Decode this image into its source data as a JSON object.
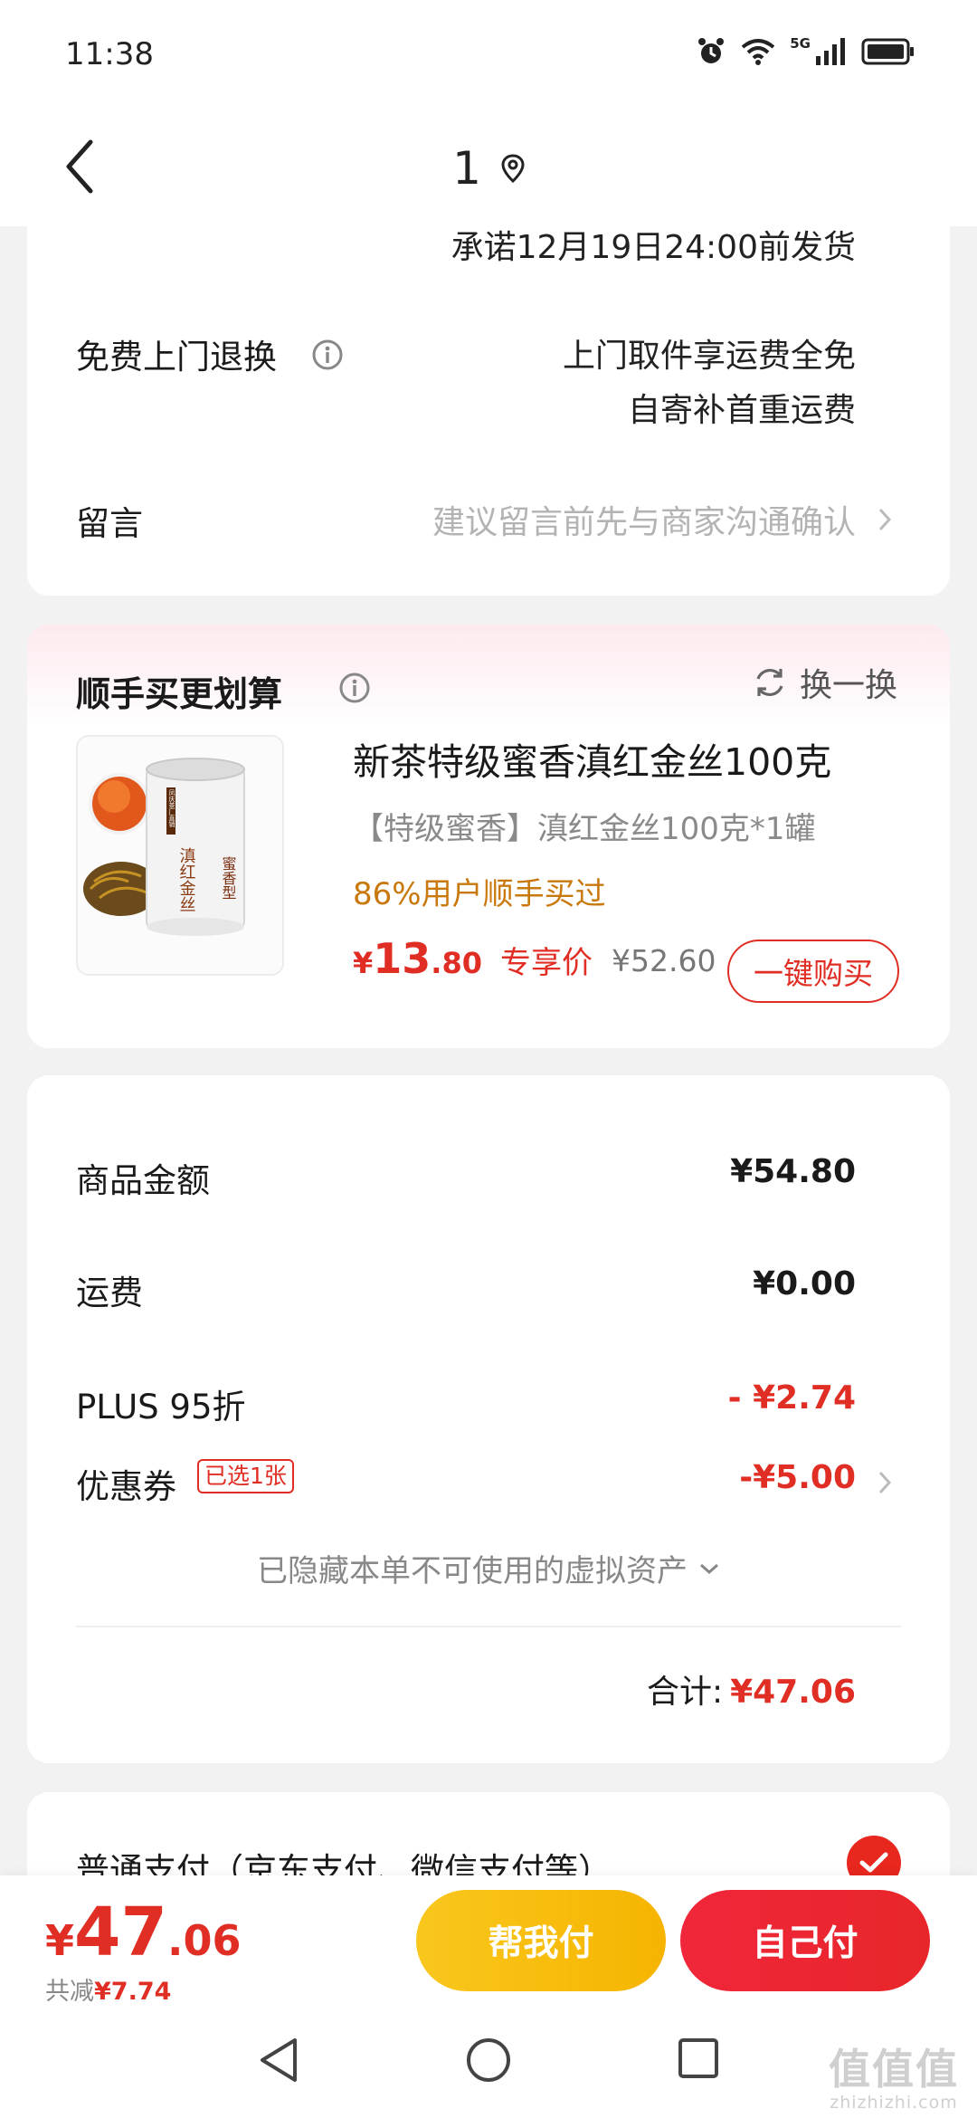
{
  "status_bar": {
    "time": "11:38",
    "network": "5G"
  },
  "nav": {
    "title": "1"
  },
  "delivery": {
    "promise": "承诺12月19日24:00前发货",
    "return_label": "免费上门退换",
    "return_line1": "上门取件享运费全免",
    "return_line2": "自寄补首重运费",
    "message_label": "留言",
    "message_placeholder": "建议留言前先与商家沟通确认"
  },
  "upsell": {
    "title": "顺手买更划算",
    "refresh_label": "换一换",
    "product_name": "新茶特级蜜香滇红金丝100克",
    "product_spec": "【特级蜜香】滇红金丝100克*1罐",
    "social_proof": "86%用户顺手买过",
    "price_symbol": "¥",
    "price_int": "13",
    "price_dec": ".80",
    "price_tag": "专享价",
    "original_price": "¥52.60",
    "buy_label": "一键购买",
    "image_text": {
      "side": "滇红金丝",
      "label": "蜜香型",
      "top": "凤庆茶厂直销"
    }
  },
  "summary": {
    "goods_label": "商品金额",
    "goods_value": "¥54.80",
    "shipping_label": "运费",
    "shipping_value": "¥0.00",
    "plus_label": "PLUS 95折",
    "plus_value": "- ¥2.74",
    "coupon_label": "优惠券",
    "coupon_badge": "已选1张",
    "coupon_value": "-¥5.00",
    "hidden_assets": "已隐藏本单不可使用的虚拟资产",
    "total_label": "合计:",
    "total_value": "¥47.06"
  },
  "payment": {
    "method_label": "普通支付（京东支付、微信支付等）",
    "selected": true
  },
  "bottom": {
    "price_symbol": "¥",
    "price_int": "47",
    "price_dec": ".06",
    "saved_label": "共减",
    "saved_value": "¥7.74",
    "help_pay_label": "帮我付",
    "self_pay_label": "自己付"
  },
  "watermark": {
    "text": "值值值",
    "subtext": "zhizhizhi.com"
  },
  "colors": {
    "accent_red": "#e02e24",
    "help_yellow": "#f7bd12",
    "social_orange": "#c9780c"
  }
}
